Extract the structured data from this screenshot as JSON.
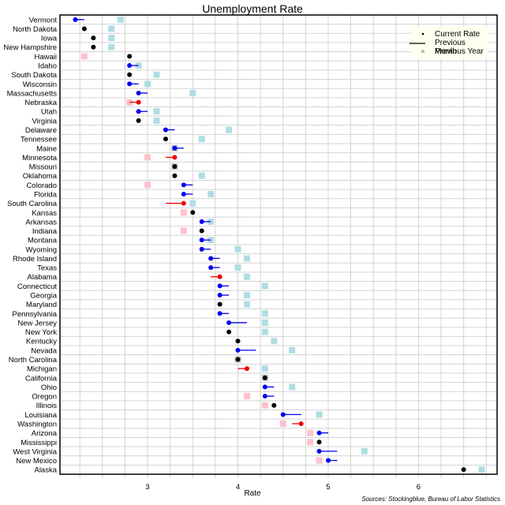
{
  "chart_data": {
    "type": "scatter",
    "title": "Unemployment Rate",
    "xlabel": "Rate",
    "ylabel": "",
    "source": "Sources: Stockingblue, Bureau of Labor Statistics",
    "xlim": [
      2.03,
      6.87
    ],
    "xticks": [
      3,
      4,
      5,
      6
    ],
    "xtick_labels": [
      "3",
      "4",
      "5",
      "6"
    ],
    "grid": true,
    "legend_position": "top-right",
    "legend": [
      {
        "key": "current",
        "label": "Current Rate"
      },
      {
        "key": "previous_month",
        "label": "Previous Month"
      },
      {
        "key": "previous_year",
        "label": "Previous Year"
      }
    ],
    "colors": {
      "decrease": "#0000ee",
      "increase": "#ee0000",
      "unchanged": "#000000",
      "year_higher": "#b0dde4",
      "year_lower": "#ffc0cb",
      "year_same": "#bebebe",
      "grid": "#d3d3d3",
      "legend_bg": "#fffff0"
    },
    "series_fields": [
      "state",
      "current",
      "previous_month",
      "previous_year"
    ],
    "rows": [
      {
        "state": "Vermont",
        "current": 2.2,
        "previous_month": 2.3,
        "previous_year": 2.7
      },
      {
        "state": "North Dakota",
        "current": 2.3,
        "previous_month": 2.3,
        "previous_year": 2.6
      },
      {
        "state": "Iowa",
        "current": 2.4,
        "previous_month": 2.4,
        "previous_year": 2.6
      },
      {
        "state": "New Hampshire",
        "current": 2.4,
        "previous_month": 2.4,
        "previous_year": 2.6
      },
      {
        "state": "Hawaii",
        "current": 2.8,
        "previous_month": 2.8,
        "previous_year": 2.3
      },
      {
        "state": "Idaho",
        "current": 2.8,
        "previous_month": 2.9,
        "previous_year": 2.9
      },
      {
        "state": "South Dakota",
        "current": 2.8,
        "previous_month": 2.8,
        "previous_year": 3.1
      },
      {
        "state": "Wisconsin",
        "current": 2.8,
        "previous_month": 2.9,
        "previous_year": 3.0
      },
      {
        "state": "Massachusetts",
        "current": 2.9,
        "previous_month": 3.0,
        "previous_year": 3.5
      },
      {
        "state": "Nebraska",
        "current": 2.9,
        "previous_month": 2.8,
        "previous_year": 2.8
      },
      {
        "state": "Utah",
        "current": 2.9,
        "previous_month": 3.0,
        "previous_year": 3.1
      },
      {
        "state": "Virginia",
        "current": 2.9,
        "previous_month": 2.9,
        "previous_year": 3.1
      },
      {
        "state": "Delaware",
        "current": 3.2,
        "previous_month": 3.3,
        "previous_year": 3.9
      },
      {
        "state": "Tennessee",
        "current": 3.2,
        "previous_month": 3.2,
        "previous_year": 3.6
      },
      {
        "state": "Maine",
        "current": 3.3,
        "previous_month": 3.4,
        "previous_year": 3.3
      },
      {
        "state": "Minnesota",
        "current": 3.3,
        "previous_month": 3.2,
        "previous_year": 3.0
      },
      {
        "state": "Missouri",
        "current": 3.3,
        "previous_month": 3.3,
        "previous_year": 3.3
      },
      {
        "state": "Oklahoma",
        "current": 3.3,
        "previous_month": 3.3,
        "previous_year": 3.6
      },
      {
        "state": "Colorado",
        "current": 3.4,
        "previous_month": 3.5,
        "previous_year": 3.0
      },
      {
        "state": "Florida",
        "current": 3.4,
        "previous_month": 3.5,
        "previous_year": 3.7
      },
      {
        "state": "South Carolina",
        "current": 3.4,
        "previous_month": 3.2,
        "previous_year": 3.5
      },
      {
        "state": "Kansas",
        "current": 3.5,
        "previous_month": 3.5,
        "previous_year": 3.4
      },
      {
        "state": "Arkansas",
        "current": 3.6,
        "previous_month": 3.7,
        "previous_year": 3.7
      },
      {
        "state": "Indiana",
        "current": 3.6,
        "previous_month": 3.6,
        "previous_year": 3.4
      },
      {
        "state": "Montana",
        "current": 3.6,
        "previous_month": 3.7,
        "previous_year": 3.7
      },
      {
        "state": "Wyoming",
        "current": 3.6,
        "previous_month": 3.7,
        "previous_year": 4.0
      },
      {
        "state": "Rhode Island",
        "current": 3.7,
        "previous_month": 3.8,
        "previous_year": 4.1
      },
      {
        "state": "Texas",
        "current": 3.7,
        "previous_month": 3.8,
        "previous_year": 4.0
      },
      {
        "state": "Alabama",
        "current": 3.8,
        "previous_month": 3.7,
        "previous_year": 4.1
      },
      {
        "state": "Connecticut",
        "current": 3.8,
        "previous_month": 3.9,
        "previous_year": 4.3
      },
      {
        "state": "Georgia",
        "current": 3.8,
        "previous_month": 3.9,
        "previous_year": 4.1
      },
      {
        "state": "Maryland",
        "current": 3.8,
        "previous_month": 3.8,
        "previous_year": 4.1
      },
      {
        "state": "Pennsylvania",
        "current": 3.8,
        "previous_month": 3.9,
        "previous_year": 4.3
      },
      {
        "state": "New Jersey",
        "current": 3.9,
        "previous_month": 4.1,
        "previous_year": 4.3
      },
      {
        "state": "New York",
        "current": 3.9,
        "previous_month": 3.9,
        "previous_year": 4.3
      },
      {
        "state": "Kentucky",
        "current": 4.0,
        "previous_month": 4.0,
        "previous_year": 4.4
      },
      {
        "state": "Nevada",
        "current": 4.0,
        "previous_month": 4.2,
        "previous_year": 4.6
      },
      {
        "state": "North Carolina",
        "current": 4.0,
        "previous_month": 4.0,
        "previous_year": 4.0
      },
      {
        "state": "Michigan",
        "current": 4.1,
        "previous_month": 4.0,
        "previous_year": 4.3
      },
      {
        "state": "California",
        "current": 4.3,
        "previous_month": 4.3,
        "previous_year": 4.3
      },
      {
        "state": "Ohio",
        "current": 4.3,
        "previous_month": 4.4,
        "previous_year": 4.6
      },
      {
        "state": "Oregon",
        "current": 4.3,
        "previous_month": 4.4,
        "previous_year": 4.1
      },
      {
        "state": "Illinois",
        "current": 4.4,
        "previous_month": 4.4,
        "previous_year": 4.3
      },
      {
        "state": "Louisiana",
        "current": 4.5,
        "previous_month": 4.7,
        "previous_year": 4.9
      },
      {
        "state": "Washington",
        "current": 4.7,
        "previous_month": 4.6,
        "previous_year": 4.5
      },
      {
        "state": "Arizona",
        "current": 4.9,
        "previous_month": 5.0,
        "previous_year": 4.8
      },
      {
        "state": "Mississippi",
        "current": 4.9,
        "previous_month": 4.9,
        "previous_year": 4.8
      },
      {
        "state": "West Virginia",
        "current": 4.9,
        "previous_month": 5.1,
        "previous_year": 5.4
      },
      {
        "state": "New Mexico",
        "current": 5.0,
        "previous_month": 5.1,
        "previous_year": 4.9
      },
      {
        "state": "Alaska",
        "current": 6.5,
        "previous_month": 6.5,
        "previous_year": 6.7
      }
    ]
  }
}
